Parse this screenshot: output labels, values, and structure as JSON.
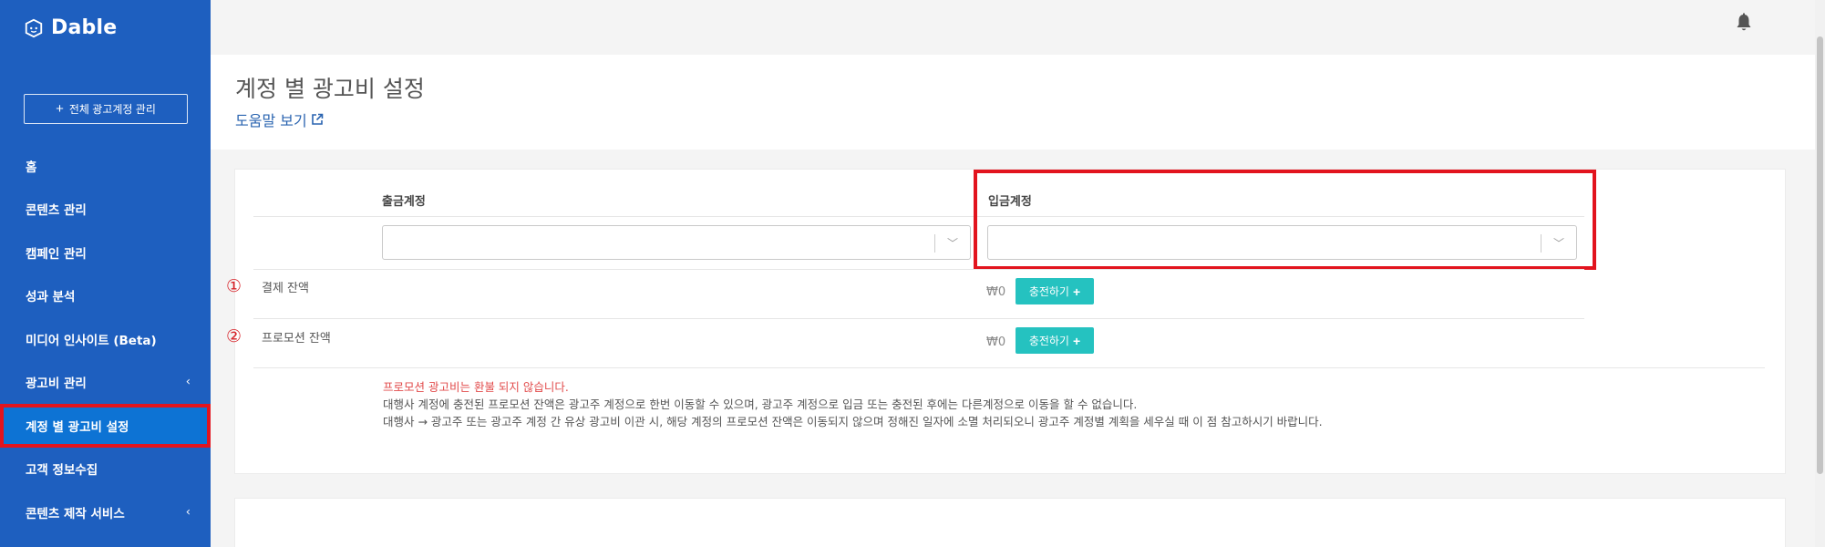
{
  "sidebar": {
    "logo_text": "Dable",
    "all_accounts_button": "전체 광고계정 관리",
    "items": [
      {
        "label": "홈",
        "has_chevron": false
      },
      {
        "label": "콘텐츠 관리",
        "has_chevron": false
      },
      {
        "label": "캠페인 관리",
        "has_chevron": false
      },
      {
        "label": "성과 분석",
        "has_chevron": false
      },
      {
        "label": "미디어 인사이트 (Beta)",
        "has_chevron": false
      },
      {
        "label": "광고비 관리",
        "has_chevron": true
      },
      {
        "label": "계정 별 광고비 설정",
        "has_chevron": false,
        "active": true
      },
      {
        "label": "고객 정보수집",
        "has_chevron": false
      },
      {
        "label": "콘텐츠 제작 서비스",
        "has_chevron": true
      }
    ],
    "chevron": "‹",
    "bg_color": "#1e5fbf",
    "active_color": "#0d73d4",
    "highlight_color": "#e2141e"
  },
  "topbar": {
    "bell_icon": "bell-icon"
  },
  "header": {
    "title": "계정 별 광고비 설정",
    "help_link": "도움말 보기",
    "help_icon": "external-link-icon"
  },
  "form": {
    "source_account_label": "출금계정",
    "target_account_label": "입금계정",
    "source_account_value": "",
    "target_account_value": "",
    "dropdown_icon": "chevron-down-icon"
  },
  "balances": {
    "payment": {
      "marker": "①",
      "label": "결제 잔액",
      "amount": "₩0",
      "button": "충전하기"
    },
    "promotion": {
      "marker": "②",
      "label": "프로모션 잔액",
      "amount": "₩0",
      "button": "충전하기"
    },
    "button_color": "#25c2c0"
  },
  "notices": {
    "warning": "프로모션 광고비는 환불 되지 않습니다.",
    "line1": "대행사 계정에 충전된 프로모션 잔액은 광고주 계정으로 한번 이동할 수 있으며, 광고주 계정으로 입금 또는 충전된 후에는 다른계정으로 이동을 할 수 없습니다.",
    "line2": "대행사 → 광고주 또는 광고주 계정 간 유상 광고비 이관 시, 해당 계정의 프로모션 잔액은 이동되지 않으며 정해진 일자에 소멸 처리되오니 광고주 계정별 계획을 세우실 때 이 점 참고하시기 바랍니다."
  }
}
